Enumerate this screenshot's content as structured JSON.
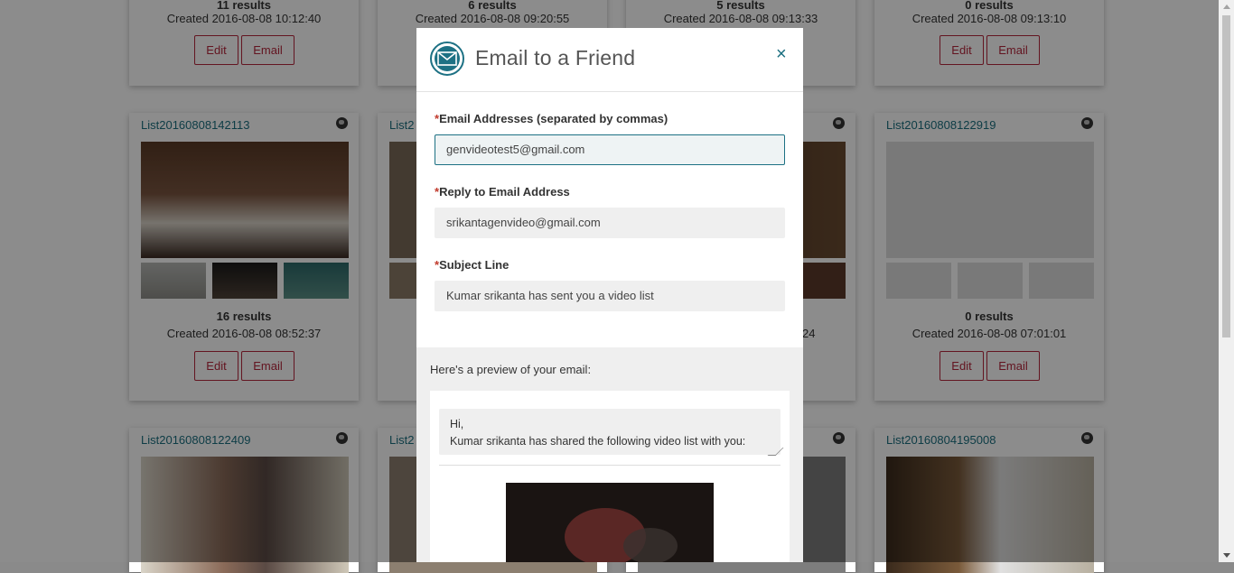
{
  "cards_top_row": [
    {
      "results": "11 results",
      "created": "Created 2016-08-08 10:12:40",
      "edit": "Edit",
      "email": "Email"
    },
    {
      "results": "6 results",
      "created": "Created 2016-08-08 09:20:55"
    },
    {
      "results": "5 results",
      "created": "Created 2016-08-08 09:13:33"
    },
    {
      "results": "0 results",
      "created": "Created 2016-08-08 09:13:10",
      "edit": "Edit",
      "email": "Email"
    }
  ],
  "cards_middle_row": [
    {
      "title": "List20160808142113",
      "results": "16 results",
      "created": "Created 2016-08-08 08:52:37",
      "edit": "Edit",
      "email": "Email"
    },
    {
      "title": "List2"
    },
    {
      "created_fragment": "24"
    },
    {
      "title": "List20160808122919",
      "results": "0 results",
      "created": "Created 2016-08-08 07:01:01",
      "edit": "Edit",
      "email": "Email"
    }
  ],
  "cards_bottom_row": [
    {
      "title": "List20160808122409"
    },
    {
      "title": "List2"
    },
    {},
    {
      "title": "List20160804195008"
    }
  ],
  "modal": {
    "title": "Email to a Friend",
    "close_glyph": "×",
    "email_addresses": {
      "label": "Email Addresses (separated by commas)",
      "value": "genvideotest5@gmail.com"
    },
    "reply_to": {
      "label": "Reply to Email Address",
      "value": "srikantagenvideo@gmail.com"
    },
    "subject": {
      "label": "Subject Line",
      "value": "Kumar srikanta has sent you a video list"
    },
    "required_mark": "*",
    "preview_label": "Here's a preview of your email:",
    "preview_message": "Hi,\nKumar srikanta has shared the following video list with you:"
  },
  "colors": {
    "accent": "#1d7184",
    "button_red": "#b5273c",
    "link": "#1b6f80"
  }
}
